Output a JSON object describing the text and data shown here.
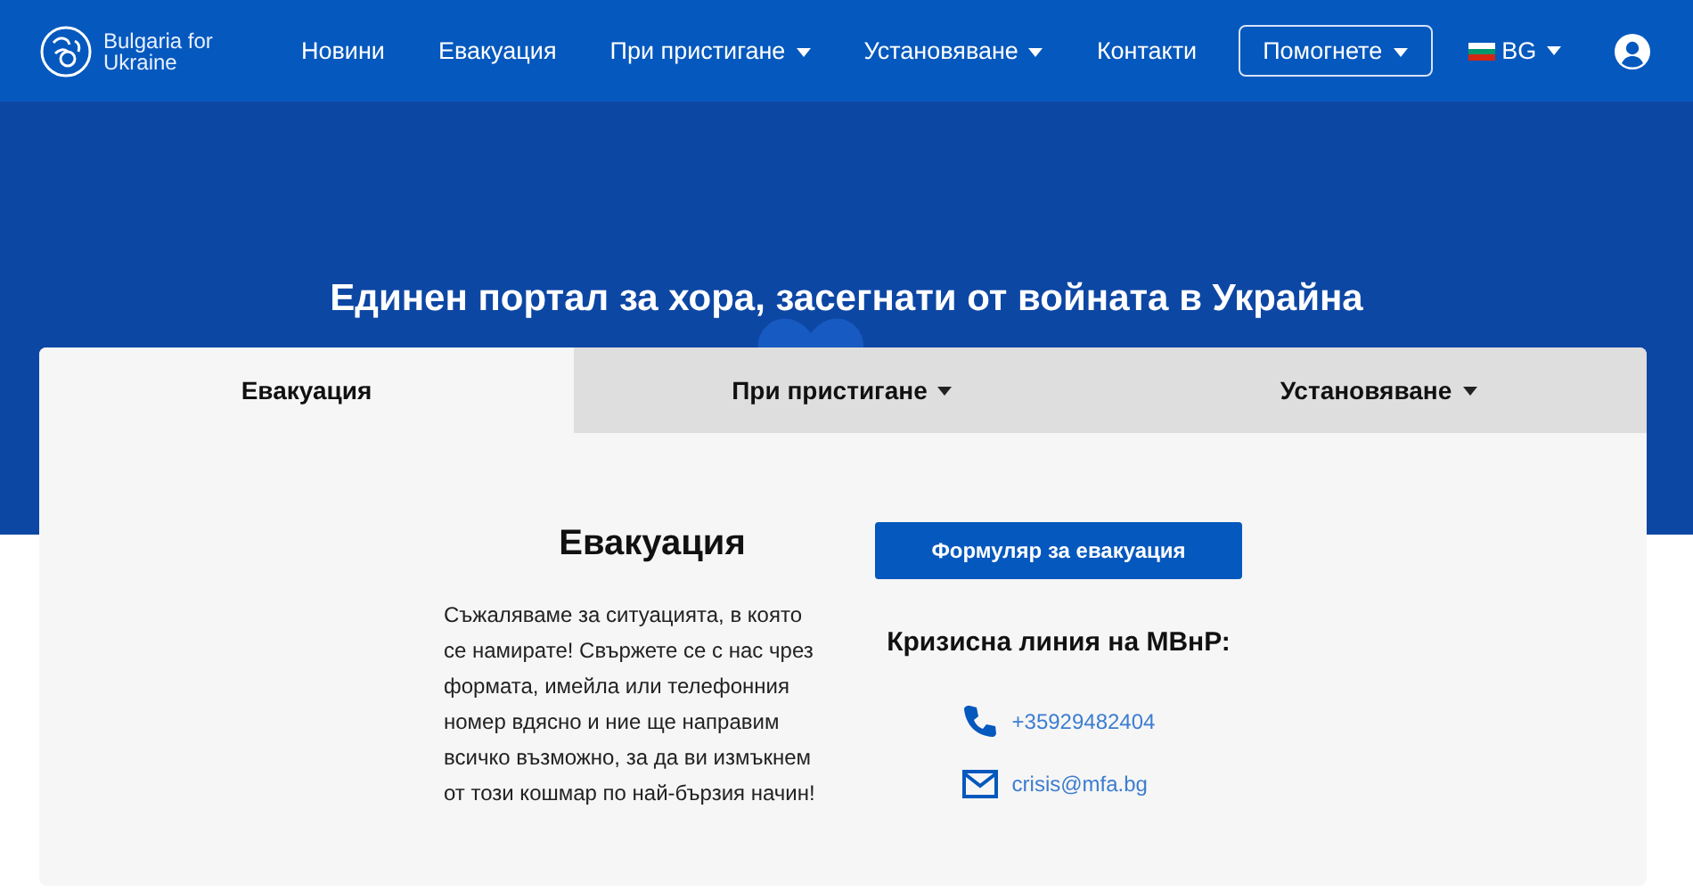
{
  "header": {
    "logo_text": "Bulgaria for Ukraine",
    "nav": [
      {
        "label": "Новини",
        "kind": "link",
        "has_menu": false
      },
      {
        "label": "Евакуация",
        "kind": "link",
        "has_menu": false
      },
      {
        "label": "При пристигане",
        "kind": "link",
        "has_menu": true
      },
      {
        "label": "Установяване",
        "kind": "link",
        "has_menu": true
      },
      {
        "label": "Контакти",
        "kind": "link",
        "has_menu": false
      },
      {
        "label": "Помогнете",
        "kind": "button",
        "has_menu": true
      }
    ],
    "language": {
      "code": "BG",
      "has_menu": true
    }
  },
  "hero": {
    "title": "Единен портал за хора, засегнати от войната в Украйна"
  },
  "tabs": [
    {
      "label": "Евакуация",
      "selected": true,
      "has_menu": false
    },
    {
      "label": "При пристигане",
      "selected": false,
      "has_menu": true
    },
    {
      "label": "Установяване",
      "selected": false,
      "has_menu": true
    }
  ],
  "panel": {
    "heading": "Евакуация",
    "text": "Съжаляваме за ситуацията, в която се намирате! Свържете се с нас чрез формата, имейла или телефонния номер вдясно и ние ще направим всичко възможно, за да ви измъкнем от този кошмар по най-бързия начин!",
    "button": "Формуляр за евакуация",
    "hotline_title": "Кризисна линия на МВнР:",
    "contacts": [
      {
        "kind": "phone",
        "value": "+35929482404"
      },
      {
        "kind": "email",
        "value": "crisis@mfa.bg"
      }
    ]
  }
}
